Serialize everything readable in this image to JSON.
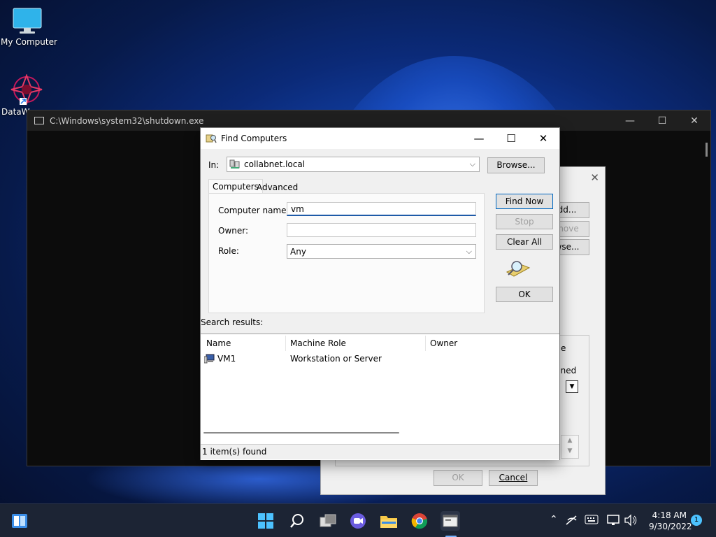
{
  "desktop": {
    "icons": [
      {
        "label": "My Computer",
        "icon": "monitor-icon"
      },
      {
        "label": "DataW",
        "icon": "datawarehouse-icon"
      }
    ]
  },
  "console": {
    "title": "C:\\Windows\\system32\\shutdown.exe",
    "min": "—",
    "max": "☐",
    "close": "✕"
  },
  "background_dialog": {
    "close": "✕",
    "add_label": "dd...",
    "remove_label": "move",
    "browse_label": "wse...",
    "group_text_1": "e",
    "group_text_2": "nned",
    "ok_label": "OK",
    "cancel_label": "Cancel"
  },
  "find_dialog": {
    "title": "Find Computers",
    "min": "—",
    "max": "☐",
    "close": "✕",
    "in_label": "In:",
    "in_value": "collabnet.local",
    "browse_label": "Browse...",
    "tabs": [
      "Computers",
      "Advanced"
    ],
    "computer_name_label": "Computer name:",
    "computer_name_value": "vm",
    "owner_label": "Owner:",
    "owner_value": "",
    "role_label": "Role:",
    "role_value": "Any",
    "find_now_label": "Find Now",
    "stop_label": "Stop",
    "clear_all_label": "Clear All",
    "ok_label": "OK",
    "search_results_label": "Search results:",
    "columns": [
      "Name",
      "Machine Role",
      "Owner"
    ],
    "rows": [
      {
        "name": "VM1",
        "role": "Workstation or Server",
        "owner": ""
      }
    ],
    "status": "1 item(s) found"
  },
  "taskbar": {
    "time": "4:18 AM",
    "date": "9/30/2022",
    "notification_count": "1"
  }
}
